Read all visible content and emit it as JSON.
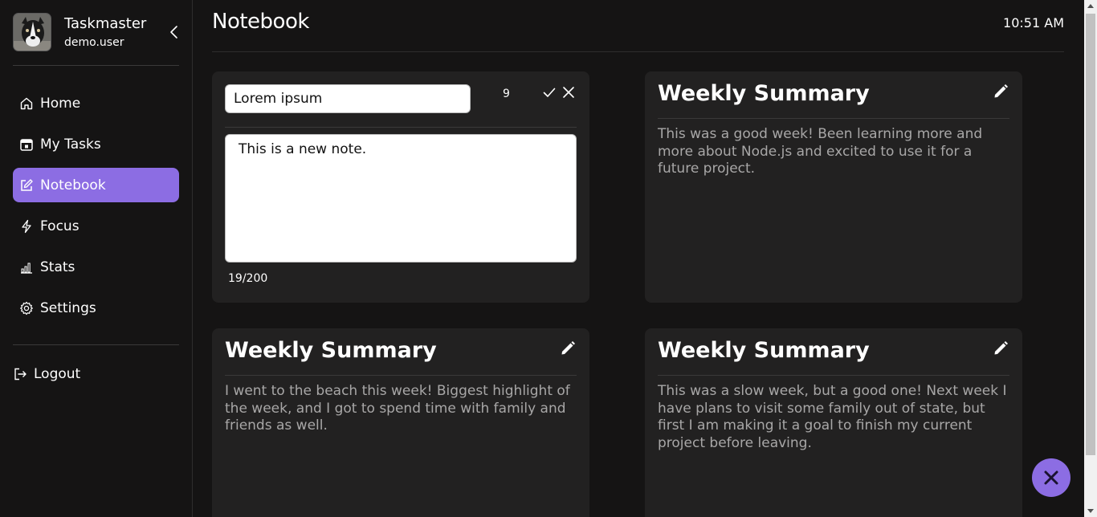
{
  "app": {
    "name": "Taskmaster",
    "username": "demo.user",
    "avatar_icon": "dog-avatar"
  },
  "sidebar": {
    "items": [
      {
        "label": "Home",
        "icon": "home-icon"
      },
      {
        "label": "My Tasks",
        "icon": "calendar-icon"
      },
      {
        "label": "Notebook",
        "icon": "edit-icon",
        "active": true
      },
      {
        "label": "Focus",
        "icon": "bolt-icon"
      },
      {
        "label": "Stats",
        "icon": "bar-chart-icon"
      },
      {
        "label": "Settings",
        "icon": "gear-icon"
      }
    ],
    "logout_label": "Logout"
  },
  "header": {
    "title": "Notebook",
    "time": "10:51 AM"
  },
  "editor": {
    "title_value": "Lorem ipsum",
    "title_remaining": "9",
    "body_value": "This is a new note.",
    "body_counter": "19/200"
  },
  "notes": [
    {
      "title": "Weekly Summary",
      "body": "This was a good week! Been learning more and more about Node.js and excited to use it for a future project."
    },
    {
      "title": "Weekly Summary",
      "body": "I went to the beach this week! Biggest highlight of the week, and I got to spend time with family and friends as well."
    },
    {
      "title": "Weekly Summary",
      "body": "This was a slow week, but a good one! Next week I have plans to visit some family out of state, but first I am making it a goal to finish my current project before leaving."
    }
  ],
  "colors": {
    "accent": "#8c6de3",
    "background": "#151414",
    "card": "#222121",
    "muted_text": "#a8a7a7"
  }
}
